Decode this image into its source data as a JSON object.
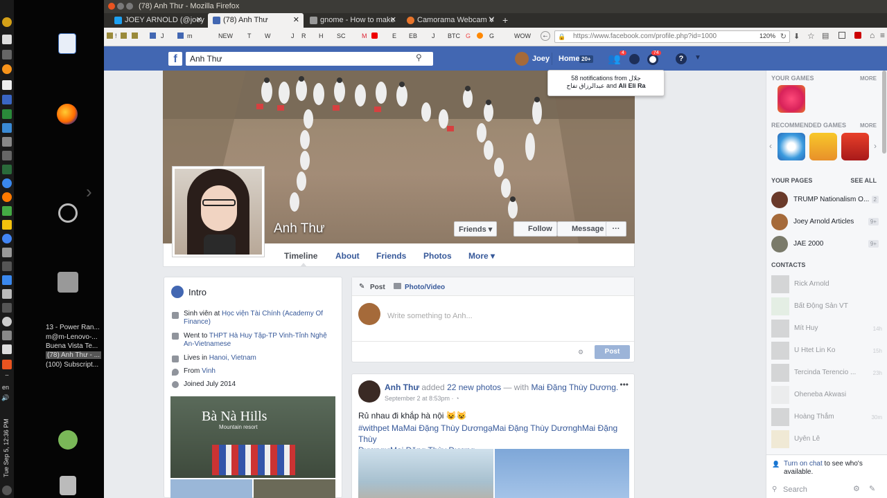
{
  "window": {
    "title": "(78) Anh Thư - Mozilla Firefox"
  },
  "tabs": [
    {
      "label": "JOEY ARNOLD (@joey",
      "color": "#1da1f2"
    },
    {
      "label": "(78) Anh Thư",
      "color": "#4267b2"
    },
    {
      "label": "gnome - How to make",
      "color": "#999999"
    },
    {
      "label": "Camorama Webcam V",
      "color": "#e8742a"
    }
  ],
  "new_tab": "+",
  "bookmarks": [
    "!",
    "f",
    "J",
    "m",
    "NEW",
    "T",
    "W",
    "J",
    "R",
    "H",
    "SC",
    "M",
    "E",
    "EB",
    "J",
    "BTC",
    "G",
    "G",
    "WOW"
  ],
  "url": "https://www.facebook.com/profile.php?id=1000",
  "zoom": "120%",
  "fb": {
    "search_value": "Anh Thư",
    "user_name": "Joey",
    "home": "Home",
    "home_count": "20+",
    "friend_badge": "4",
    "notif_badge": "74",
    "tooltip_line1": "58 notifications from جلال",
    "tooltip_line2_prefix": "عبدالرزاق تفاح",
    "tooltip_and": "and",
    "tooltip_name": "Ali Eli Ra"
  },
  "profile": {
    "name": "Anh Thư",
    "buttons": {
      "friends": "Friends ▾",
      "follow": "Follow",
      "message": "Message",
      "more": "···"
    },
    "tabs": [
      "Timeline",
      "About",
      "Friends",
      "Photos",
      "More ▾"
    ]
  },
  "intro": {
    "title": "Intro",
    "rows": [
      {
        "prefix": "Sinh viên at ",
        "link": "Học viện Tài Chính (Academy Of Finance)"
      },
      {
        "prefix": "Went to ",
        "link": "THPT Hà Huy Tập-TP Vinh-Tỉnh Nghệ An-Vietnamese"
      },
      {
        "prefix": "Lives in ",
        "link": "Hanoi, Vietnam"
      },
      {
        "prefix": "From ",
        "link": "Vinh"
      },
      {
        "prefix": "Joined July 2014",
        "link": ""
      }
    ],
    "photo_sign": "Bà Nà Hills",
    "photo_sub": "Mountain resort"
  },
  "composer": {
    "tab_post": "Post",
    "tab_photo": "Photo/Video",
    "placeholder": "Write something to Anh...",
    "post_btn": "Post"
  },
  "post": {
    "author": "Anh Thư",
    "added": " added ",
    "photos": "22 new photos",
    "with": " — with ",
    "tagged": "Mai Đặng Thùy Dương.",
    "time": "September 2 at 8:53pm · ",
    "text": "Rủ nhau đi khắp hà nội 😺😺",
    "tags_line1": "#withpet MaMai Đặng Thùy DươngạMai Đặng Thùy DươnghMai Đặng Thùy",
    "tags_line2": "DươngưMai Đặng Thùy Dương"
  },
  "sidebar": {
    "your_games": "YOUR GAMES",
    "more": "MORE",
    "recommended": "RECOMMENDED GAMES",
    "more2": "MORE",
    "your_pages": "YOUR PAGES",
    "see_all": "SEE ALL",
    "pages": [
      {
        "name": "TRUMP Nationalism O...",
        "count": "2"
      },
      {
        "name": "Joey Arnold Articles",
        "count": "9+"
      },
      {
        "name": "JAE 2000",
        "count": "9+"
      }
    ],
    "contacts_title": "CONTACTS",
    "contacts": [
      {
        "name": "Rick Arnold",
        "time": ""
      },
      {
        "name": "Bất Động Sản VT",
        "time": ""
      },
      {
        "name": "Mít Huy",
        "time": "14h"
      },
      {
        "name": "U Htet Lin Ko",
        "time": "15h"
      },
      {
        "name": "Tercinda Terencio ...",
        "time": "23h"
      },
      {
        "name": "Oheneba Akwasi",
        "time": ""
      },
      {
        "name": "Hoàng Thắm",
        "time": "30m"
      },
      {
        "name": "Uyên Lê",
        "time": ""
      }
    ],
    "chat_link": "Turn on chat",
    "chat_rest": " to see who's",
    "chat_rest2": "available.",
    "search_placeholder": "Search"
  },
  "taskbar": {
    "items": [
      "13 - Power Ran...",
      "m@m-Lenovo-...",
      "Buena Vista Te...",
      "(78) Anh Thư - ...",
      "(100) Subscript..."
    ],
    "clock": "Tue Sep 5, 12:36 PM",
    "lang": "en"
  }
}
